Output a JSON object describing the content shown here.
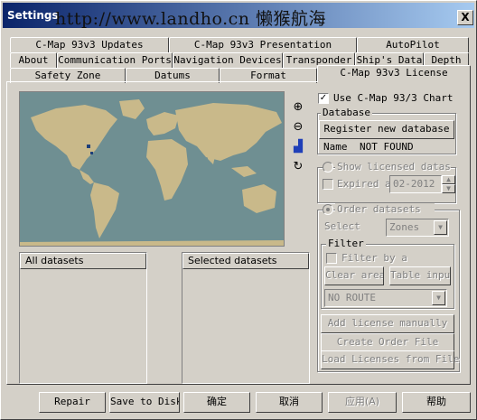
{
  "window": {
    "title": "Settings",
    "watermark": "http://www.landho.cn 懒猴航海",
    "close_label": "X"
  },
  "tabs_row1": [
    "C-Map 93v3 Updates",
    "C-Map 93v3 Presentation",
    "AutoPilot"
  ],
  "tabs_row2": [
    "About",
    "Communication Ports",
    "Navigation Devices",
    "Transponder",
    "Ship's Data",
    "Depth"
  ],
  "tabs_row3": [
    "Safety Zone",
    "Datums",
    "Format",
    "C-Map 93v3 License"
  ],
  "map_tools": [
    "zoom-in",
    "zoom-out",
    "select",
    "rotate"
  ],
  "lists": {
    "all": "All datasets",
    "selected": "Selected datasets"
  },
  "license": {
    "use_cmap": "Use C-Map 93/3 Chart",
    "use_cmap_checked": true,
    "database_label": "Database",
    "register_button": "Register new database",
    "name_label": "Name",
    "name_value": "NOT FOUND",
    "show_licensed": "Show licensed datasets",
    "expired_label": "Expired at",
    "expired_value": "02-2012",
    "order_dataset": "Order datasets",
    "select_label": "Select",
    "select_value": "Zones",
    "filter_label": "Filter",
    "filter_by_area": "Filter by area",
    "clear_area": "Clear area",
    "table_input": "Table input",
    "route_value": "NO ROUTE",
    "add_manual": "Add license manually",
    "create_order": "Create Order File",
    "load_licenses": "Load Licenses from File"
  },
  "footer": {
    "repair": "Repair",
    "save_disk": "Save to Disk",
    "ok": "确定",
    "cancel": "取消",
    "apply": "应用(A)",
    "help": "帮助"
  },
  "colors": {
    "titlebar_start": "#0a246a",
    "face": "#d4d0c8",
    "sea": "#6f8f92",
    "land": "#c9b98a"
  }
}
